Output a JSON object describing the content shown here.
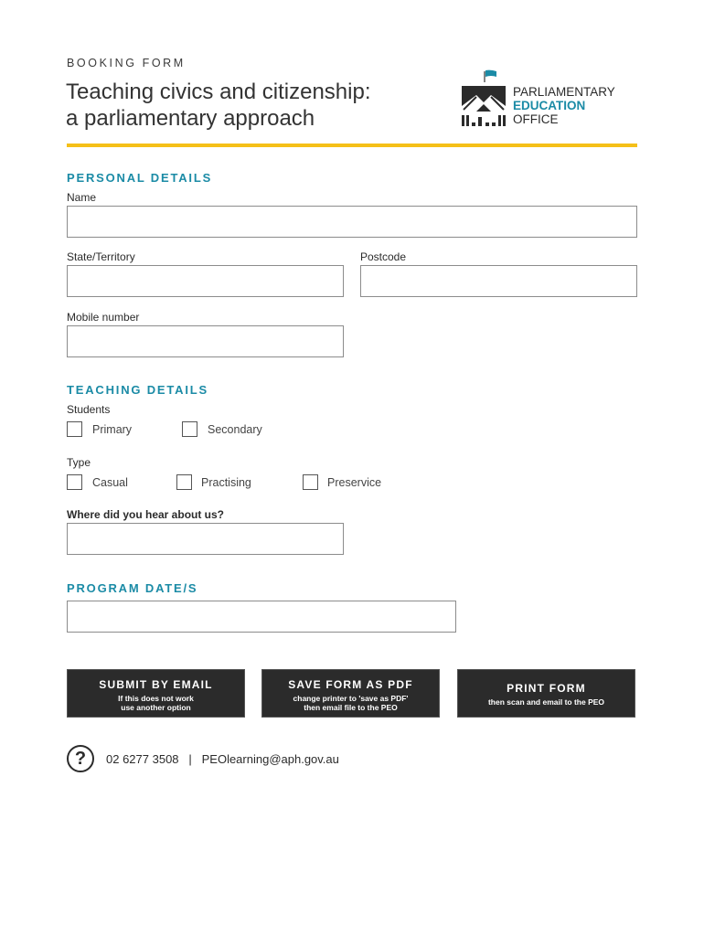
{
  "header": {
    "kicker": "BOOKING FORM",
    "title_line1": "Teaching civics and citizenship:",
    "title_line2": "a parliamentary approach",
    "accent_color": "#f5c018",
    "logo": {
      "line1": "PARLIAMENTARY",
      "line2": "EDUCATION",
      "line3": "OFFICE",
      "brand_color": "#1b8ba6"
    }
  },
  "personal": {
    "heading": "PERSONAL DETAILS",
    "name_label": "Name",
    "name_value": "",
    "state_label": "State/Territory",
    "state_value": "",
    "postcode_label": "Postcode",
    "postcode_value": "",
    "mobile_label": "Mobile number",
    "mobile_value": ""
  },
  "teaching": {
    "heading": "TEACHING DETAILS",
    "students_label": "Students",
    "students_options": [
      {
        "label": "Primary",
        "checked": false
      },
      {
        "label": "Secondary",
        "checked": false
      }
    ],
    "type_label": "Type",
    "type_options": [
      {
        "label": "Casual",
        "checked": false
      },
      {
        "label": "Practising",
        "checked": false
      },
      {
        "label": "Preservice",
        "checked": false
      }
    ],
    "hear_label": "Where did you hear about us?",
    "hear_value": ""
  },
  "program": {
    "heading": "PROGRAM DATE/S",
    "dates_value": ""
  },
  "buttons": [
    {
      "title": "SUBMIT BY EMAIL",
      "sub1": "If this does not work",
      "sub2": "use another option"
    },
    {
      "title": "SAVE FORM AS PDF",
      "sub1": "change printer to 'save as PDF'",
      "sub2": "then email file to the PEO"
    },
    {
      "title": "PRINT FORM",
      "sub1": "then scan and email to the PEO",
      "sub2": ""
    }
  ],
  "contact": {
    "icon": "question-icon",
    "phone": "02 6277 3508",
    "separator": "|",
    "email": "PEOlearning@aph.gov.au"
  }
}
